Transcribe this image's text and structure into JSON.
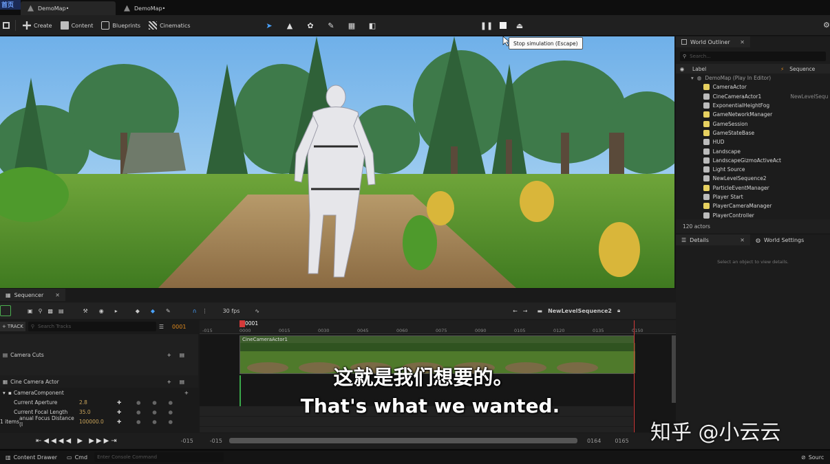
{
  "logo_text": "首页",
  "tabs": [
    {
      "label": "DemoMap•"
    },
    {
      "label": "DemoMap•"
    }
  ],
  "toolbar": {
    "create": "Create",
    "content": "Content",
    "blueprints": "Blueprints",
    "cinematics": "Cinematics",
    "mode_icons": [
      "select-mode-icon",
      "landscape-mode-icon",
      "foliage-mode-icon",
      "paint-mode-icon",
      "fracture-mode-icon",
      "modeling-mode-icon"
    ],
    "tooltip": "Stop simulation (Escape)"
  },
  "outliner": {
    "title": "World Outliner",
    "search_placeholder": "Search...",
    "col_label": "Label",
    "col_sequence": "Sequence",
    "root": "DemoMap (Play In Editor)",
    "items": [
      {
        "label": "CameraActor",
        "seq": ""
      },
      {
        "label": "CineCameraActor1",
        "seq": "NewLevelSequ"
      },
      {
        "label": "ExponentialHeightFog",
        "seq": ""
      },
      {
        "label": "GameNetworkManager",
        "seq": ""
      },
      {
        "label": "GameSession",
        "seq": ""
      },
      {
        "label": "GameStateBase",
        "seq": ""
      },
      {
        "label": "HUD",
        "seq": ""
      },
      {
        "label": "Landscape",
        "seq": ""
      },
      {
        "label": "LandscapeGizmoActiveAct",
        "seq": ""
      },
      {
        "label": "Light Source",
        "seq": ""
      },
      {
        "label": "NewLevelSequence2",
        "seq": ""
      },
      {
        "label": "ParticleEventManager",
        "seq": ""
      },
      {
        "label": "Player Start",
        "seq": ""
      },
      {
        "label": "PlayerCameraManager",
        "seq": ""
      },
      {
        "label": "PlayerController",
        "seq": ""
      }
    ],
    "count": "120 actors"
  },
  "details": {
    "tab_details": "Details",
    "tab_world_settings": "World Settings",
    "empty_hint": "Select an object to view details."
  },
  "sequencer": {
    "tab": "Sequencer",
    "fps": "30 fps",
    "sequence_name": "NewLevelSequence2",
    "track_button": "TRACK",
    "search_placeholder": "Search Tracks",
    "current_frame": "0001",
    "playhead_label": "0001",
    "ruler": [
      "-015",
      "0000",
      "0015",
      "0030",
      "0045",
      "0060",
      "0075",
      "0090",
      "0105",
      "0120",
      "0135",
      "0150"
    ],
    "section_label": "CineCameraActor1",
    "tracks": {
      "camera_cuts": "Camera Cuts",
      "cine_camera_actor": "Cine Camera Actor",
      "camera_component": "CameraComponent",
      "aperture_label": "Current Aperture",
      "aperture_value": "2.8",
      "focal_label": "Current Focal Length",
      "focal_value": "35.0",
      "focus_label": "anual Focus Distance (I",
      "focus_value": "100000.0"
    },
    "items_count": "1 items",
    "range_start_a": "-015",
    "range_start_b": "-015",
    "range_end_a": "0164",
    "range_end_b": "0165"
  },
  "status": {
    "content_drawer": "Content Drawer",
    "cmd": "Cmd",
    "console_placeholder": "Enter Console Command",
    "source": "Sourc"
  },
  "subtitles": {
    "cn": "这就是我们想要的。",
    "en": "That's what we wanted."
  },
  "watermark": "知乎 @小云云",
  "colors": {
    "accent_orange": "#e08a1e",
    "playhead_red": "#d43a3a",
    "sky": "#7db7e6",
    "grass": "#4f8a2a"
  }
}
